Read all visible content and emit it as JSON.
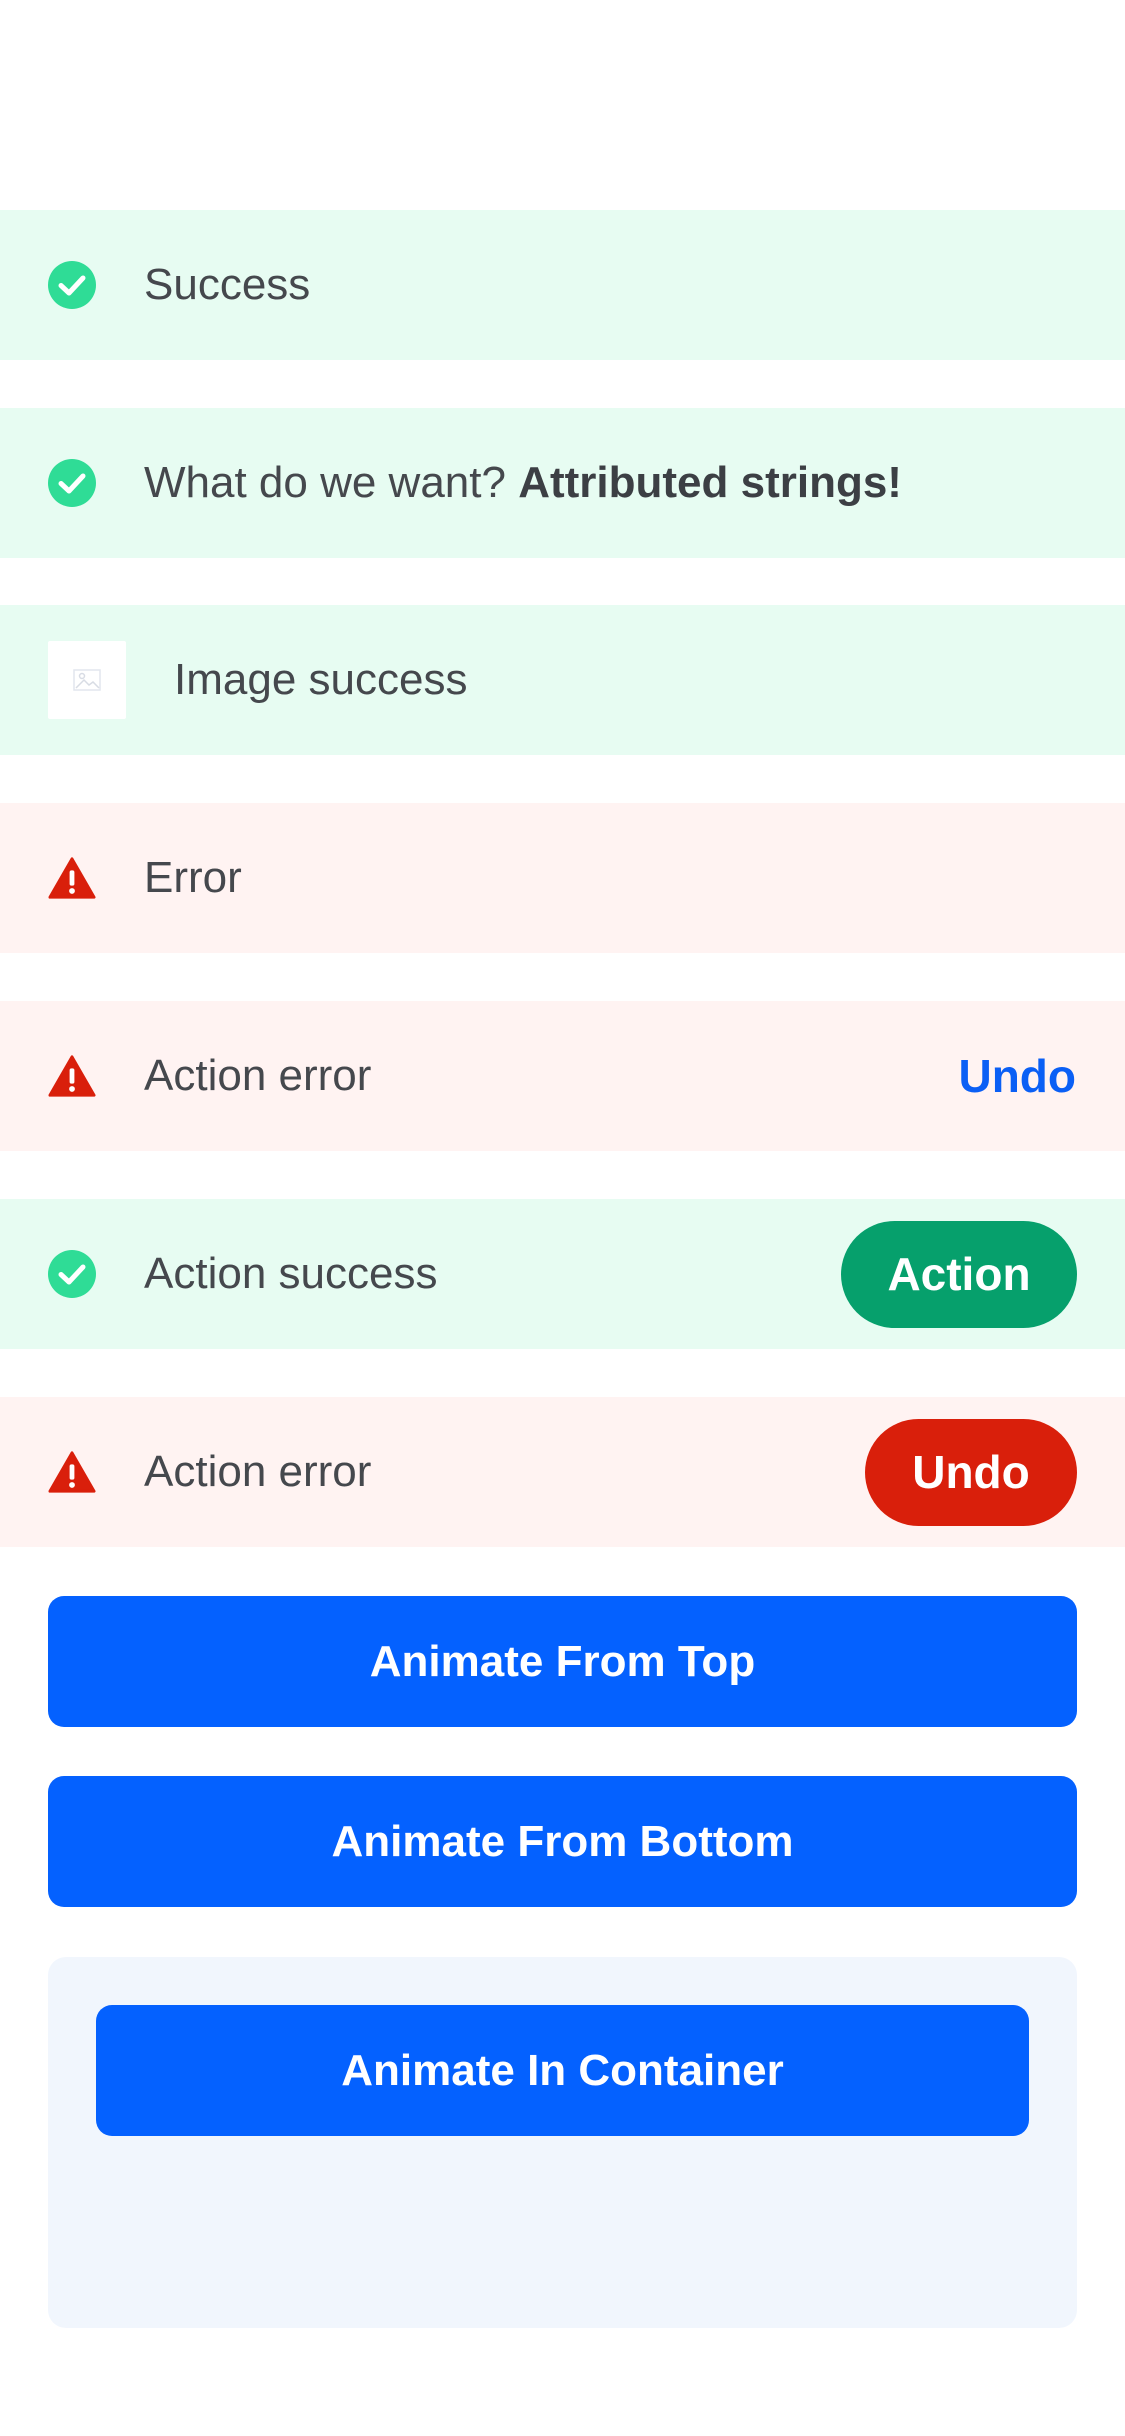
{
  "banners": [
    {
      "type": "success",
      "icon": "check-circle-icon",
      "message": "Success"
    },
    {
      "type": "success",
      "icon": "check-circle-icon",
      "message_plain": "What do we want? ",
      "message_bold": "Attributed strings!"
    },
    {
      "type": "success",
      "icon": "image-placeholder-icon",
      "message": "Image success"
    },
    {
      "type": "error",
      "icon": "warning-triangle-icon",
      "message": "Error"
    },
    {
      "type": "error",
      "icon": "warning-triangle-icon",
      "message": "Action error",
      "action_label": "Undo"
    },
    {
      "type": "success",
      "icon": "check-circle-icon",
      "message": "Action success",
      "action_label": "Action"
    },
    {
      "type": "error",
      "icon": "warning-triangle-icon",
      "message": "Action error",
      "action_label": "Undo"
    }
  ],
  "buttons": {
    "animate_from_top": "Animate From Top",
    "animate_from_bottom": "Animate From Bottom",
    "animate_in_container": "Animate In Container"
  },
  "colors": {
    "success_bg": "#e7fcf2",
    "error_bg": "#fff3f2",
    "success_icon": "#2fdc96",
    "error_icon": "#d91f0b",
    "primary_blue": "#0461ff",
    "action_green": "#06a06c",
    "action_red": "#d91f0b",
    "container_bg": "#f1f6fd"
  }
}
